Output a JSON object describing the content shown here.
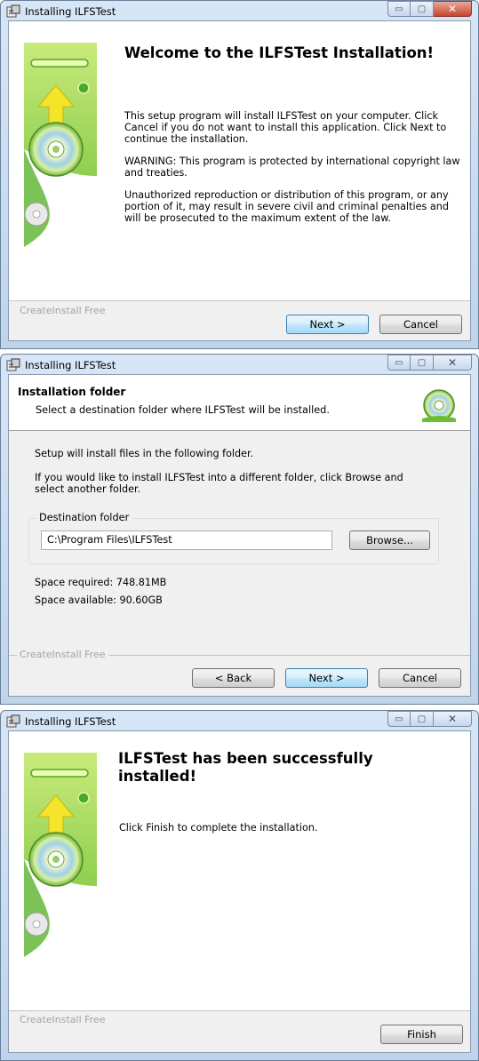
{
  "app_title": "Installing ILFSTest",
  "window_buttons": {
    "minimize": "▭",
    "maximize": "▢",
    "close": "✕"
  },
  "welcome": {
    "heading": "Welcome to the ILFSTest  Installation!",
    "paragraphs": [
      "This setup program will install ILFSTest  on your computer. Click Cancel if you do not want to install this application. Click Next to continue the installation.",
      "WARNING: This program is protected by international copyright law and treaties.",
      "Unauthorized reproduction or distribution of this program, or any portion of it, may result in severe civil and criminal penalties and will be prosecuted to the maximum extent of the law."
    ],
    "brand": "CreateInstall Free",
    "next_label": "Next >",
    "cancel_label": "Cancel"
  },
  "folder": {
    "heading": "Installation folder",
    "subheading": "Select a destination folder where ILFSTest  will be installed.",
    "intro": "Setup will install files in the following folder.",
    "instructions": "If you would like to install ILFSTest  into a different folder, click Browse and select another folder.",
    "group_label": "Destination folder",
    "path_value": "C:\\Program Files\\ILFSTest",
    "browse_label": "Browse...",
    "space_required": "Space required: 748.81MB",
    "space_available": "Space available: 90.60GB",
    "brand": "CreateInstall Free",
    "back_label": "< Back",
    "next_label": "Next >",
    "cancel_label": "Cancel"
  },
  "finish": {
    "heading": "ILFSTest  has been successfully installed!",
    "message": "Click Finish to complete the installation.",
    "brand": "CreateInstall Free",
    "finish_label": "Finish"
  },
  "colors": {
    "art_green_light": "#b7e06a",
    "art_green_dark": "#3e9a22",
    "arrow_yellow": "#f4e42a",
    "default_button_border": "#3c7fb1"
  },
  "icons": [
    "installer-app-icon",
    "minimize-icon",
    "maximize-icon",
    "close-icon",
    "cd-disc-icon",
    "install-arrow-icon"
  ]
}
